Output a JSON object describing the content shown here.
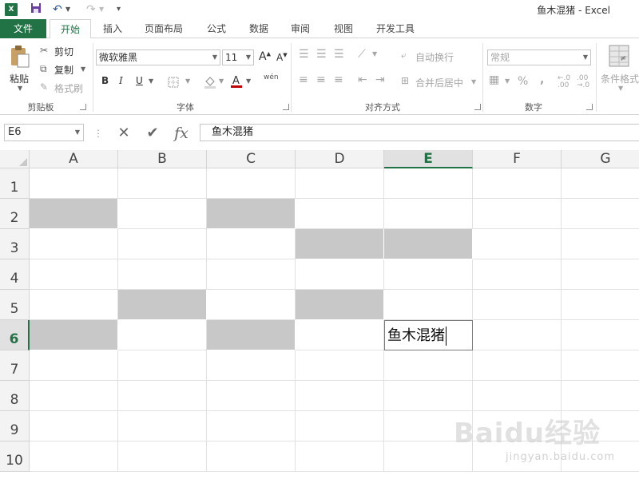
{
  "window": {
    "title": "鱼木混猪 - Excel"
  },
  "tabs": [
    "文件",
    "开始",
    "插入",
    "页面布局",
    "公式",
    "数据",
    "审阅",
    "视图",
    "开发工具"
  ],
  "active_tab": "开始",
  "ribbon": {
    "clipboard": {
      "paste": "粘贴",
      "cut": "剪切",
      "copy": "复制",
      "format_painter": "格式刷",
      "label": "剪贴板"
    },
    "font": {
      "name": "微软雅黑",
      "size": "11",
      "bold": "B",
      "italic": "I",
      "underline": "U",
      "phonetic": "wén",
      "label": "字体"
    },
    "alignment": {
      "wrap_text": "自动换行",
      "merge_center": "合并后居中",
      "label": "对齐方式"
    },
    "number": {
      "format": "常规",
      "percent": "%",
      "comma": ",",
      "label": "数字"
    },
    "styles": {
      "conditional": "条件格式"
    }
  },
  "formula_bar": {
    "name_box": "E6",
    "cancel": "✕",
    "enter": "✔",
    "fx": "fx",
    "value": "鱼木混猪"
  },
  "columns": [
    "A",
    "B",
    "C",
    "D",
    "E",
    "F",
    "G"
  ],
  "rows": [
    "1",
    "2",
    "3",
    "4",
    "5",
    "6",
    "7",
    "8",
    "9",
    "10"
  ],
  "selected_column": "E",
  "selected_row": "6",
  "filled_cells": [
    "A2",
    "C2",
    "D3",
    "E3",
    "B5",
    "D5",
    "A6",
    "C6"
  ],
  "cell_values": {
    "E6": "鱼木混猪"
  },
  "colors": {
    "accent": "#217346",
    "fill_gray": "#c8c8c8"
  },
  "watermark": {
    "main": "Baidu经验",
    "sub": "jingyan.baidu.com"
  }
}
